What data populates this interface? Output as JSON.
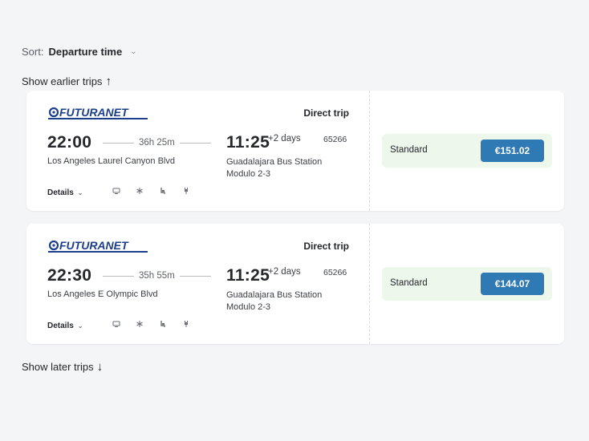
{
  "sort": {
    "label": "Sort:",
    "value": "Departure time"
  },
  "show_earlier": "Show earlier trips",
  "show_later": "Show later trips",
  "colors": {
    "price_button": "#2f79b5",
    "fare_background": "#eef7ec",
    "brand_navy": "#1c3f8c"
  },
  "trips": [
    {
      "operator": "FUTURANET",
      "trip_type": "Direct trip",
      "departure_time": "22:00",
      "duration": "36h 25m",
      "arrival_time": "11:25",
      "plus_days": "+2 days",
      "bus_number": "65266",
      "from": "Los Angeles Laurel Canyon Blvd",
      "to": "Guadalajara Bus Station Modulo 2-3",
      "details_label": "Details",
      "amenities": [
        "wifi-icon",
        "air-conditioning-icon",
        "legroom-icon",
        "power-outlet-icon"
      ],
      "fare_name": "Standard",
      "price": "€151.02"
    },
    {
      "operator": "FUTURANET",
      "trip_type": "Direct trip",
      "departure_time": "22:30",
      "duration": "35h 55m",
      "arrival_time": "11:25",
      "plus_days": "+2 days",
      "bus_number": "65266",
      "from": "Los Angeles E Olympic Blvd",
      "to": "Guadalajara Bus Station Modulo 2-3",
      "details_label": "Details",
      "amenities": [
        "wifi-icon",
        "air-conditioning-icon",
        "legroom-icon",
        "power-outlet-icon"
      ],
      "fare_name": "Standard",
      "price": "€144.07"
    }
  ]
}
